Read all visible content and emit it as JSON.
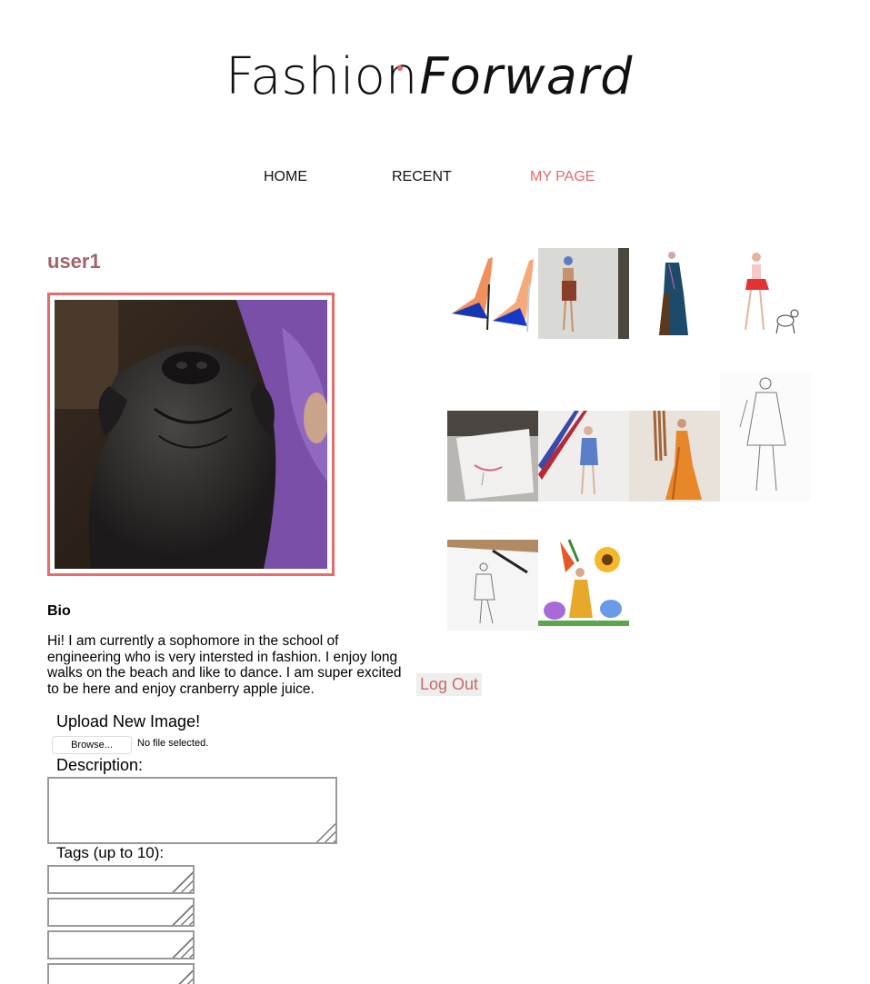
{
  "logo": {
    "part1": "Fashion",
    "part2": "Forward"
  },
  "nav": {
    "items": [
      {
        "label": "HOME"
      },
      {
        "label": "RECENT"
      },
      {
        "label": "MY PAGE"
      }
    ]
  },
  "profile": {
    "username": "user1",
    "bio_label": "Bio",
    "bio_text": "Hi! I am currently a sophomore in the school of engineering who is very intersted in fashion. I enjoy long walks on the beach and like to dance. I am super excited to be here and enjoy cranberry apple juice."
  },
  "upload": {
    "title": "Upload New Image!",
    "browse_label": "Browse...",
    "no_file_text": "No file selected.",
    "description_label": "Description:",
    "tags_label": "Tags (up to 10):"
  },
  "logout_label": "Log Out",
  "colors": {
    "accent": "#e86a6a",
    "username": "#a0646a"
  }
}
